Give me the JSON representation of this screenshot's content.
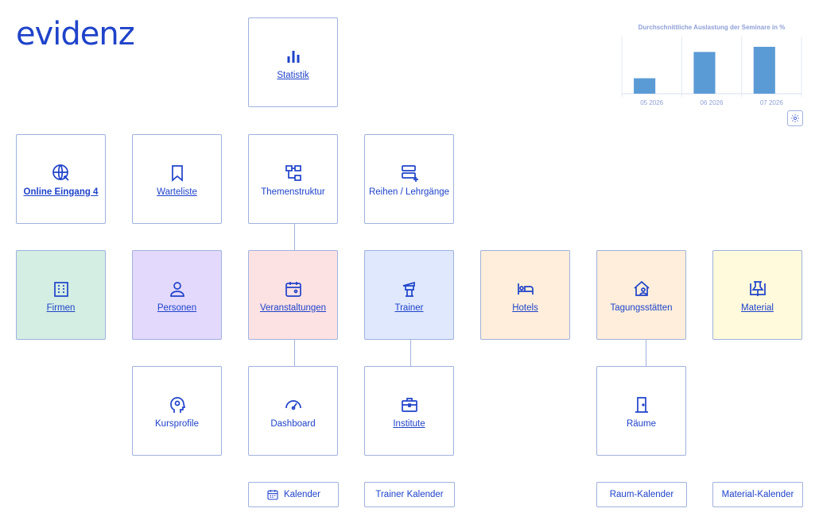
{
  "brand": {
    "logo": "evidenz"
  },
  "chart_data": {
    "type": "bar",
    "title": "Durchschnittliche Auslastung der Seminare in %",
    "categories": [
      "05 2026",
      "06 2026",
      "07 2026"
    ],
    "values": [
      27,
      73,
      82
    ],
    "ylim": [
      0,
      100
    ],
    "xlabel": "",
    "ylabel": "",
    "grid": true,
    "bar_color": "#5b9bd5"
  },
  "settings": {
    "gear_label": ""
  },
  "tiles": {
    "statistik": "Statistik",
    "online": "Online Eingang 4",
    "warteliste": "Warteliste",
    "themen": "Themenstruktur",
    "reihen": "Reihen / Lehrgänge",
    "firmen": "Firmen",
    "personen": "Personen",
    "veranstaltungen": "Veranstaltungen",
    "trainer": "Trainer",
    "hotels": "Hotels",
    "tagung": "Tagungsstätten",
    "material": "Material",
    "kursprofile": "Kursprofile",
    "dashboard": "Dashboard",
    "institute": "Institute",
    "raeume": "Räume"
  },
  "colors": {
    "firmen": "#d4eee3",
    "personen": "#e2d9fd",
    "veranstaltungen": "#fde2e4",
    "trainer": "#dfe8fd",
    "hotels": "#feeedb",
    "tagung": "#feeedb",
    "material": "#fffadc"
  },
  "buttons": {
    "kalender": "Kalender",
    "trainer_kalender": "Trainer Kalender",
    "raum_kalender": "Raum-Kalender",
    "material_kalender": "Material-Kalender"
  }
}
